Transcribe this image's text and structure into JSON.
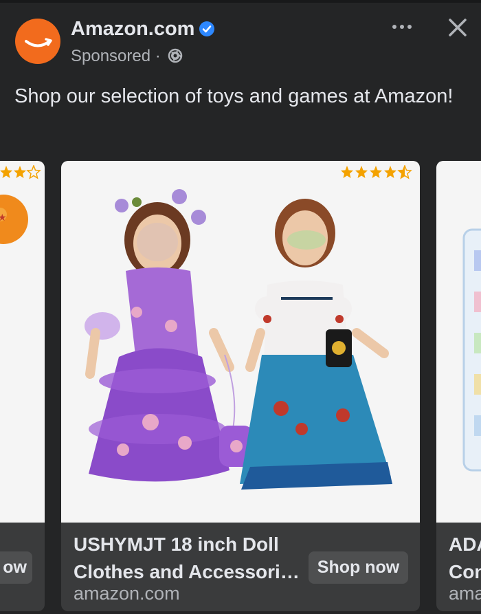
{
  "post": {
    "page_name": "Amazon.com",
    "sponsored_label": "Sponsored",
    "separator": "·",
    "caption": "Shop our selection of toys and games at Amazon!",
    "icons": [
      "amazon-logo",
      "verified-badge-icon",
      "globe-icon",
      "more-options-icon",
      "close-icon"
    ]
  },
  "carousel": {
    "prev_card": {
      "button_partial": "ow"
    },
    "main_card": {
      "title_line1": "USHYMJT 18 inch Doll",
      "title_line2": "Clothes and Accessori…",
      "domain": "amazon.com",
      "button": "Shop now",
      "rating_stars": 4.5
    },
    "next_card": {
      "title_line1": "ADA",
      "title_line2": "Con",
      "domain": "ama"
    }
  },
  "colors": {
    "background": "#242526",
    "card_footer": "#3a3b3c",
    "button": "#4e4f50",
    "verified": "#2d88ff",
    "amazon_orange": "#f26b1d",
    "star": "#f4a200"
  }
}
